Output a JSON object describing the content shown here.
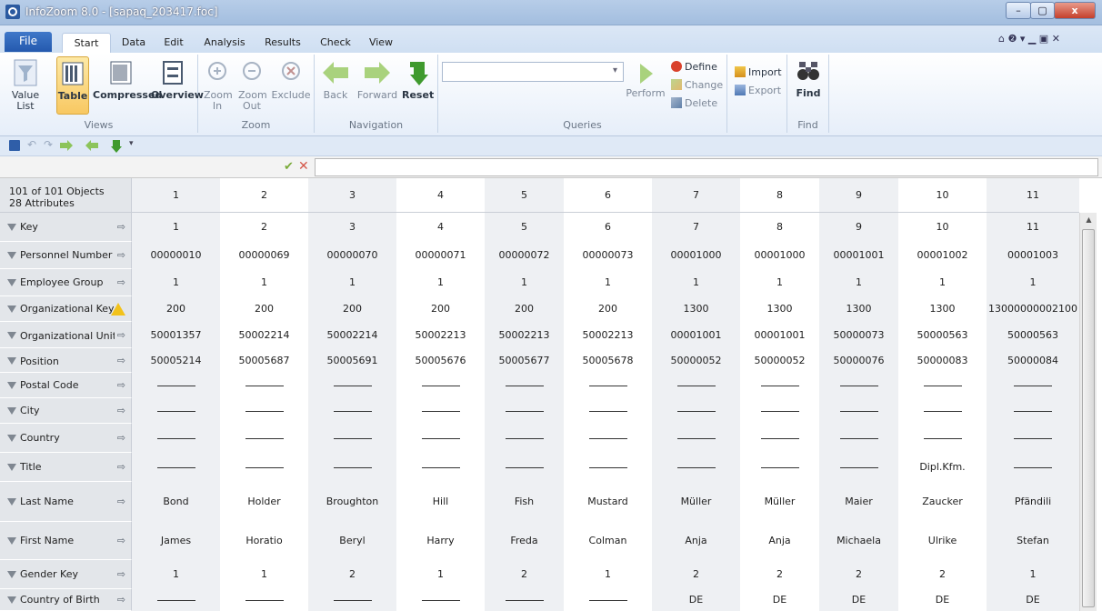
{
  "window": {
    "title": "InfoZoom 8.0 - [sapaq_203417.foc]",
    "min_label": "–",
    "max_label": "▢",
    "close_label": "x"
  },
  "ribbon_tabs": {
    "file": "File",
    "start": "Start",
    "data": "Data",
    "edit": "Edit",
    "analysis": "Analysis",
    "results": "Results",
    "check": "Check",
    "view": "View",
    "right_controls": "⌂ ❷ ▾ ▁ ▣ ✕"
  },
  "ribbon": {
    "value_list": [
      "Value",
      "List"
    ],
    "table": "Table",
    "compressed": "Compressed",
    "overview": "Overview",
    "views_label": "Views",
    "zoom_in": [
      "Zoom",
      "In"
    ],
    "zoom_out": [
      "Zoom",
      "Out"
    ],
    "exclude": "Exclude",
    "zoom_label": "Zoom",
    "back": "Back",
    "forward": "Forward",
    "reset": "Reset",
    "navigation_label": "Navigation",
    "perform": "Perform",
    "define": "Define",
    "change": "Change",
    "delete": "Delete",
    "queries_label": "Queries",
    "import": "Import",
    "export": "Export",
    "find": "Find",
    "find_label": "Find"
  },
  "grid": {
    "objects": "101 of 101 Objects",
    "attributes": "28 Attributes",
    "columns": [
      "1",
      "2",
      "3",
      "4",
      "5",
      "6",
      "7",
      "8",
      "9",
      "10",
      "11"
    ],
    "rows": [
      {
        "name": "Key",
        "values": [
          "1",
          "2",
          "3",
          "4",
          "5",
          "6",
          "7",
          "8",
          "9",
          "10",
          "11"
        ]
      },
      {
        "name": "Personnel Number",
        "values": [
          "00000010",
          "00000069",
          "00000070",
          "00000071",
          "00000072",
          "00000073",
          "00001000",
          "00001000",
          "00001001",
          "00001002",
          "00001003"
        ]
      },
      {
        "name": "Employee Group",
        "values": [
          "1",
          "1",
          "1",
          "1",
          "1",
          "1",
          "1",
          "1",
          "1",
          "1",
          "1"
        ]
      },
      {
        "name": "Organizational Key",
        "values": [
          "200",
          "200",
          "200",
          "200",
          "200",
          "200",
          "1300",
          "1300",
          "1300",
          "1300",
          "13000000002100"
        ],
        "warning": true
      },
      {
        "name": "Organizational Unit",
        "values": [
          "50001357",
          "50002214",
          "50002214",
          "50002213",
          "50002213",
          "50002213",
          "00001001",
          "00001001",
          "50000073",
          "50000563",
          "50000563"
        ]
      },
      {
        "name": "Position",
        "values": [
          "50005214",
          "50005687",
          "50005691",
          "50005676",
          "50005677",
          "50005678",
          "50000052",
          "50000052",
          "50000076",
          "50000083",
          "50000084"
        ]
      },
      {
        "name": "Postal Code",
        "values": [
          "—",
          "—",
          "—",
          "—",
          "—",
          "—",
          "—",
          "—",
          "—",
          "—",
          "—"
        ]
      },
      {
        "name": "City",
        "values": [
          "—",
          "—",
          "—",
          "—",
          "—",
          "—",
          "—",
          "—",
          "—",
          "—",
          "—"
        ]
      },
      {
        "name": "Country",
        "values": [
          "—",
          "—",
          "—",
          "—",
          "—",
          "—",
          "—",
          "—",
          "—",
          "—",
          "—"
        ]
      },
      {
        "name": "Title",
        "values": [
          "—",
          "—",
          "—",
          "—",
          "—",
          "—",
          "—",
          "—",
          "—",
          "Dipl.Kfm.",
          "—"
        ]
      },
      {
        "name": "Last Name",
        "values": [
          "Bond",
          "Holder",
          "Broughton",
          "Hill",
          "Fish",
          "Mustard",
          "Müller",
          "Müller",
          "Maier",
          "Zaucker",
          "Pfändili"
        ]
      },
      {
        "name": "First Name",
        "values": [
          "James",
          "Horatio",
          "Beryl",
          "Harry",
          "Freda",
          "Colman",
          "Anja",
          "Anja",
          "Michaela",
          "Ulrike",
          "Stefan"
        ]
      },
      {
        "name": "Gender Key",
        "values": [
          "1",
          "1",
          "2",
          "1",
          "2",
          "1",
          "2",
          "2",
          "2",
          "2",
          "1"
        ]
      },
      {
        "name": "Country of Birth",
        "values": [
          "—",
          "—",
          "—",
          "—",
          "—",
          "—",
          "DE",
          "DE",
          "DE",
          "DE",
          "DE"
        ]
      }
    ]
  }
}
